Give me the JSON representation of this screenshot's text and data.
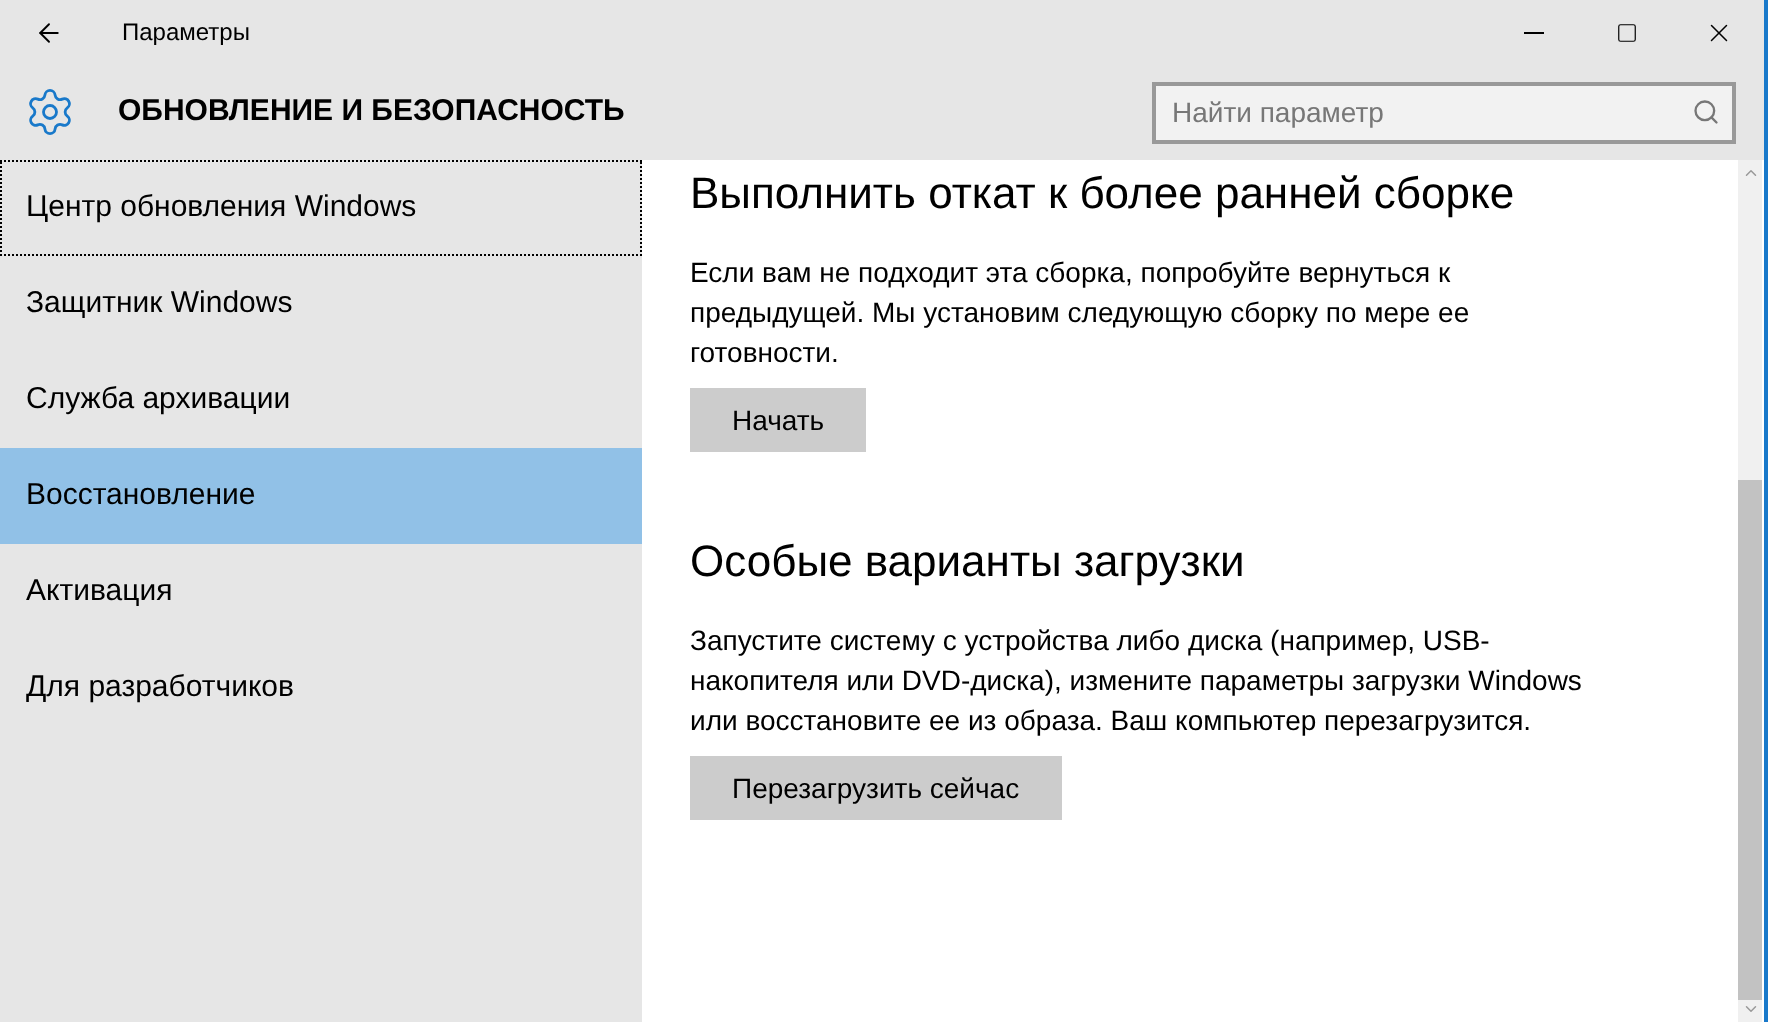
{
  "window": {
    "title": "Параметры"
  },
  "header": {
    "title": "ОБНОВЛЕНИЕ И БЕЗОПАСНОСТЬ"
  },
  "search": {
    "placeholder": "Найти параметр"
  },
  "sidebar": {
    "items": [
      {
        "label": "Центр обновления Windows",
        "selected": false,
        "focused": true
      },
      {
        "label": "Защитник Windows",
        "selected": false,
        "focused": false
      },
      {
        "label": "Служба архивации",
        "selected": false,
        "focused": false
      },
      {
        "label": "Восстановление",
        "selected": true,
        "focused": false
      },
      {
        "label": "Активация",
        "selected": false,
        "focused": false
      },
      {
        "label": "Для разработчиков",
        "selected": false,
        "focused": false
      }
    ]
  },
  "sections": [
    {
      "title": "Выполнить откат к более ранней сборке",
      "text": "Если вам не подходит эта сборка, попробуйте вернуться к предыдущей. Мы установим следующую сборку по мере ее готовности.",
      "button": "Начать"
    },
    {
      "title": "Особые варианты загрузки",
      "text": "Запустите систему с устройства либо диска (например, USB-накопителя или DVD-диска), измените параметры загрузки Windows или восстановите ее из образа. Ваш компьютер перезагрузится.",
      "button": "Перезагрузить сейчас"
    }
  ]
}
